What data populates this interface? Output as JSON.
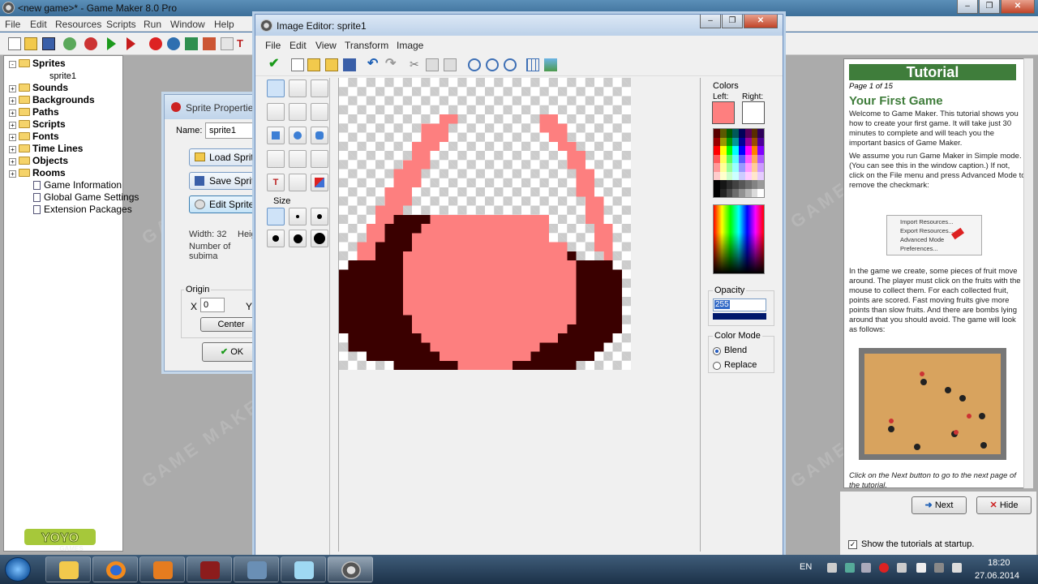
{
  "main_window": {
    "title": "<new game>* - Game Maker 8.0 Pro",
    "menu": [
      "File",
      "Edit",
      "Resources",
      "Scripts",
      "Run",
      "Window",
      "Help"
    ]
  },
  "resource_tree": [
    {
      "label": "Sprites",
      "bold": true,
      "folder": true
    },
    {
      "label": "sprite1",
      "bold": false,
      "child": true
    },
    {
      "label": "Sounds",
      "bold": true,
      "folder": true
    },
    {
      "label": "Backgrounds",
      "bold": true,
      "folder": true
    },
    {
      "label": "Paths",
      "bold": true,
      "folder": true
    },
    {
      "label": "Scripts",
      "bold": true,
      "folder": true
    },
    {
      "label": "Fonts",
      "bold": true,
      "folder": true
    },
    {
      "label": "Time Lines",
      "bold": true,
      "folder": true
    },
    {
      "label": "Objects",
      "bold": true,
      "folder": true
    },
    {
      "label": "Rooms",
      "bold": true,
      "folder": true
    },
    {
      "label": "Game Information",
      "bold": false
    },
    {
      "label": "Global Game Settings",
      "bold": false
    },
    {
      "label": "Extension Packages",
      "bold": false
    }
  ],
  "sprite_properties": {
    "title": "Sprite Properties",
    "name_label": "Name:",
    "name_value": "sprite1",
    "load_btn": "Load Sprite",
    "save_btn": "Save Sprite",
    "edit_btn": "Edit Sprite",
    "width_text": "Width: 32",
    "height_text": "Heig",
    "subimages_text": "Number of subima",
    "origin_label": "Origin",
    "x_label": "X",
    "x_value": "0",
    "y_label": "Y",
    "center_btn": "Center",
    "ok_btn": "OK"
  },
  "image_editor": {
    "title": "Image Editor: sprite1",
    "menu": [
      "File",
      "Edit",
      "View",
      "Transform",
      "Image"
    ],
    "size_label": "Size",
    "colors_label": "Colors",
    "left_label": "Left:",
    "right_label": "Right:",
    "left_color": "#fe7f7f",
    "right_color": "#ffffff",
    "opacity_label": "Opacity",
    "opacity_value": "255",
    "color_mode_label": "Color Mode",
    "blend_label": "Blend",
    "replace_label": "Replace",
    "pixel_colors": {
      "pink": "#fd7f7f",
      "dark": "#3a0000"
    }
  },
  "tutorial": {
    "header": "Tutorial",
    "page": "Page 1 of 15",
    "title": "Your First Game",
    "p1": "Welcome to Game Maker. This tutorial shows you how to create your first game. It will take just 30 minutes to complete and will teach you the important basics of Game Maker.",
    "p2": "We assume you run Game Maker in Simple mode. (You can see this in the window caption.) If not, click on the File menu and press Advanced Mode to remove the checkmark:",
    "menu_items": [
      "Import Resources...",
      "Export Resources...",
      "Advanced Mode",
      "Preferences..."
    ],
    "p3": "In the game we create, some pieces of fruit move around. The player must click on the fruits with the mouse to collect them. For each collected fruit, points are scored. Fast moving fruits give more points than slow fruits. And there are bombs lying around that you should avoid. The game will look as follows:",
    "p4": "Click on the Next button to go to the next page of the tutorial.",
    "next_btn": "Next",
    "hide_btn": "Hide",
    "startup_label": "Show the tutorials at startup."
  },
  "tray": {
    "lang": "EN",
    "time": "18:20",
    "date": "27.06.2014"
  }
}
